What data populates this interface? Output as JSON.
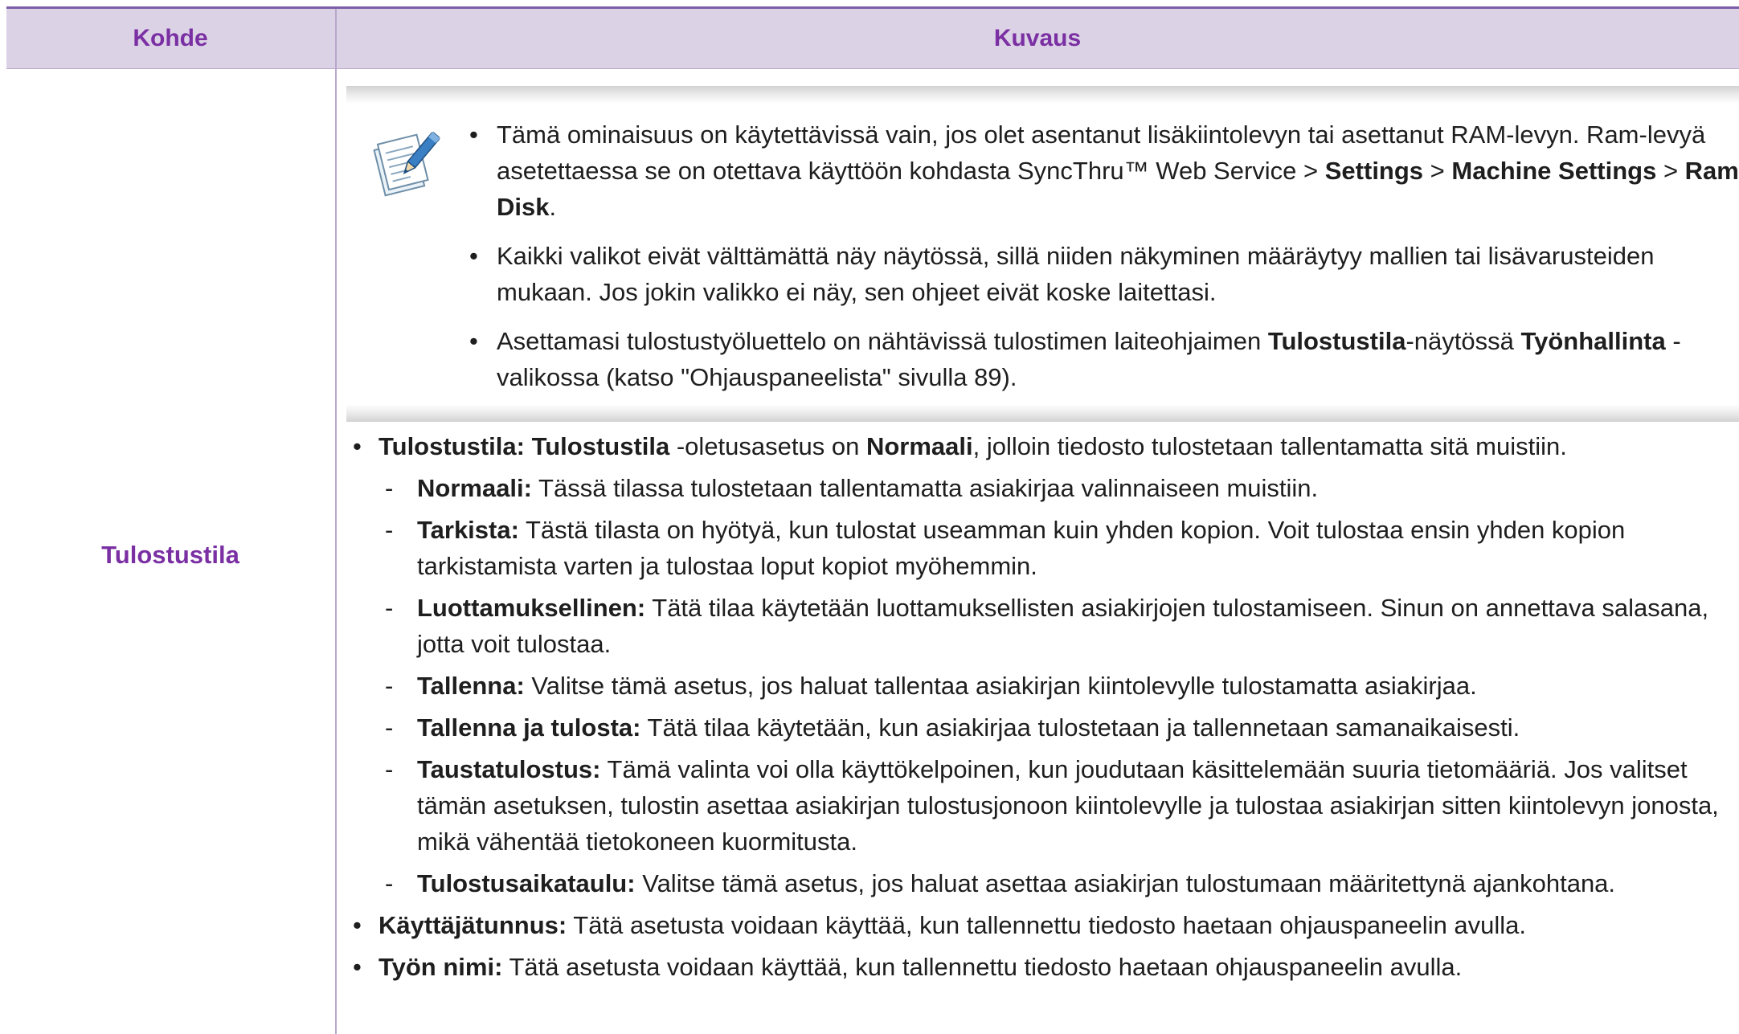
{
  "table": {
    "headers": {
      "item": "Kohde",
      "description": "Kuvaus"
    },
    "row_label": "Tulostustila"
  },
  "note": {
    "icon": "note-pencil-icon",
    "items": [
      {
        "t1": "Tämä ominaisuus on käytettävissä vain, jos olet asentanut lisäkiintolevyn tai asettanut RAM-levyn. Ram-levyä asetettaessa se on otettava käyttöön kohdasta SyncThru™ Web Service > ",
        "b1": "Settings",
        "t2": " > ",
        "b2": "Machine Settings",
        "t3": " > ",
        "b3": "Ram Disk",
        "t4": "."
      },
      {
        "t1": "Kaikki valikot eivät välttämättä näy näytössä, sillä niiden näkyminen määräytyy mallien tai lisävarusteiden mukaan. Jos jokin valikko ei näy, sen ohjeet eivät koske laitettasi."
      },
      {
        "t1": "Asettamasi tulostustyöluettelo on nähtävissä tulostimen laiteohjaimen ",
        "b1": "Tulostustila",
        "t2": "-näytössä ",
        "b2": "Työnhallinta",
        "t3": " -valikossa (katso \"Ohjauspaneelista\" sivulla 89)."
      }
    ]
  },
  "description": {
    "mode": {
      "b1": "Tulostustila: Tulostustila",
      "t1": " -oletusasetus on ",
      "b2": "Normaali",
      "t2": ", jolloin tiedosto tulostetaan tallentamatta sitä muistiin."
    },
    "sub_items": [
      {
        "term": "Normaali:",
        "text": " Tässä tilassa tulostetaan tallentamatta asiakirjaa valinnaiseen muistiin."
      },
      {
        "term": "Tarkista:",
        "text": " Tästä tilasta on hyötyä, kun tulostat useamman kuin yhden kopion. Voit tulostaa ensin yhden kopion tarkistamista varten ja tulostaa loput kopiot myöhemmin."
      },
      {
        "term": "Luottamuksellinen:",
        "text": " Tätä tilaa käytetään luottamuksellisten asiakirjojen tulostamiseen. Sinun on annettava salasana, jotta voit tulostaa."
      },
      {
        "term": "Tallenna:",
        "text": " Valitse tämä asetus, jos haluat tallentaa asiakirjan kiintolevylle tulostamatta asiakirjaa."
      },
      {
        "term": "Tallenna ja tulosta:",
        "text": " Tätä tilaa käytetään, kun asiakirjaa tulostetaan ja tallennetaan samanaikaisesti."
      },
      {
        "term": "Taustatulostus:",
        "text": " Tämä valinta voi olla käyttökelpoinen, kun joudutaan käsittelemään suuria tietomääriä. Jos valitset tämän asetuksen, tulostin asettaa asiakirjan tulostusjonoon kiintolevylle ja tulostaa asiakirjan sitten kiintolevyn jonosta, mikä vähentää tietokoneen kuormitusta."
      },
      {
        "term": "Tulostusaikataulu:",
        "text": " Valitse tämä asetus, jos haluat asettaa asiakirjan tulostumaan määritettynä ajankohtana."
      }
    ],
    "user_id": {
      "term": "Käyttäjätunnus:",
      "text": " Tätä asetusta voidaan käyttää, kun tallennettu tiedosto haetaan ohjauspaneelin avulla."
    },
    "job_name": {
      "term": "Työn nimi:",
      "text": " Tätä asetusta voidaan käyttää, kun tallennettu tiedosto haetaan ohjauspaneelin avulla."
    }
  }
}
